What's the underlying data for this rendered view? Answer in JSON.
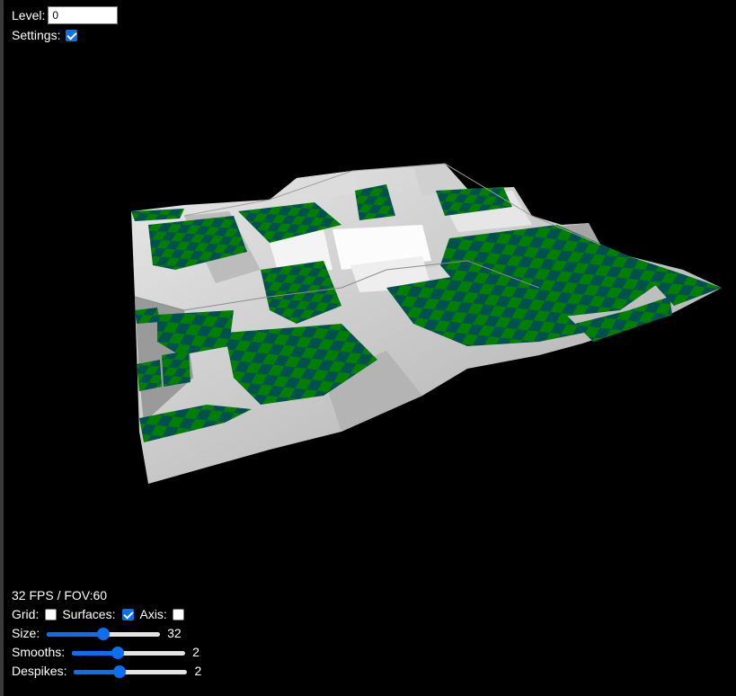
{
  "top": {
    "level_label": "Level:",
    "level_value": "0",
    "settings_label": "Settings:",
    "settings_checked": true
  },
  "stats": {
    "fps_text": "32 FPS / FOV:60"
  },
  "toggles": {
    "grid_label": "Grid:",
    "grid_checked": false,
    "surfaces_label": "Surfaces:",
    "surfaces_checked": true,
    "axis_label": "Axis:",
    "axis_checked": false
  },
  "sliders": {
    "size_label": "Size:",
    "size_value": "32",
    "size_fraction": 0.5,
    "smooths_label": "Smooths:",
    "smooths_value": "2",
    "smooths_fraction": 0.4,
    "despikes_label": "Despikes:",
    "despikes_value": "2",
    "despikes_fraction": 0.4
  },
  "colors": {
    "background": "#000000",
    "terrain_light": "#c8c8c8",
    "tile_green": "#007f00",
    "tile_teal": "#005050",
    "accent_blue": "#0b6ff0"
  }
}
